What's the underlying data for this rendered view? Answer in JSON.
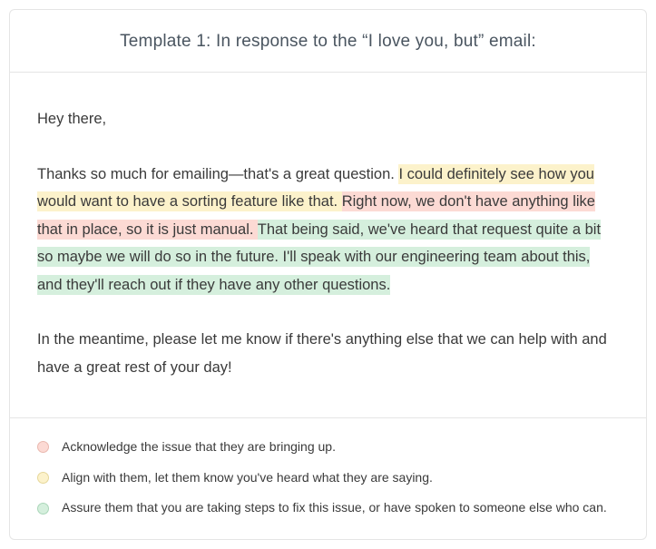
{
  "header": {
    "title": "Template 1: In response to the “I love you, but” email:"
  },
  "body": {
    "greeting": "Hey there,",
    "intro_plain": "Thanks so much for emailing—that's a great question. ",
    "highlight_yellow": "I could definitely see how you would want to have a sorting feature like that. ",
    "highlight_red": "Right now, we don't have anything like that in place, so it is just manual. ",
    "highlight_green": "That being said, we've heard that request quite a bit so maybe we will do so in the future. I'll speak with our engineering team about this, and they'll reach out if they have any other questions.",
    "closing": "In the meantime, please let me know if there's anything else that we can help with and have a great rest of your day!"
  },
  "legend": {
    "items": [
      {
        "color": "red",
        "text": "Acknowledge the issue that they are bringing up."
      },
      {
        "color": "yellow",
        "text": "Align with them, let them know you've heard what they are saying."
      },
      {
        "color": "green",
        "text": "Assure them that you are taking steps to fix this issue, or have spoken to someone else who can."
      }
    ]
  }
}
